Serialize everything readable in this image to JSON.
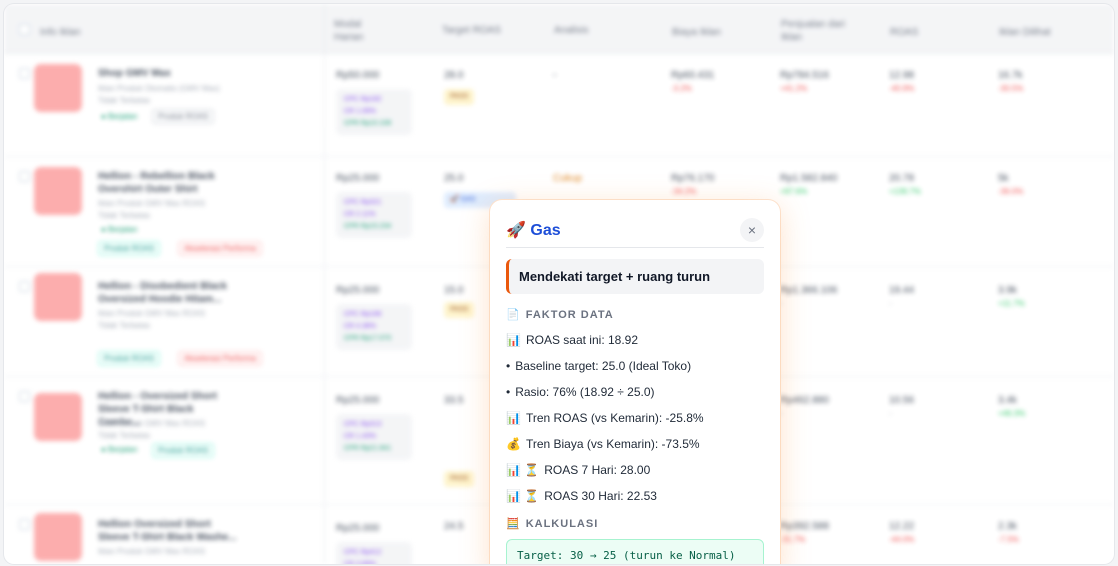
{
  "table": {
    "headers": {
      "info": "Info Iklan",
      "modal": "Modal Harian",
      "target": "Target ROAS",
      "analisis": "Analisis",
      "biaya": "Biaya Iklan",
      "penjualan": "Penjualan dari Iklan",
      "roas": "ROAS",
      "dilihat": "Iklan Dilihat"
    },
    "rows": [
      {
        "name": "Shop GMV Max",
        "sub1": "Iklan Produk Otomatis (GMV Max)",
        "sub2": "Tidak Terbatas",
        "status": "● Berjalan",
        "tag": "Produk ROAS",
        "modal": "Rp50.000",
        "target": "28.0",
        "analisis": "-",
        "biaya": "Rp60.431",
        "biaya_delta": "-3.2%",
        "penjualan": "Rp784.516",
        "penjualan_delta": "+41.2%",
        "roas": "12.98",
        "roas_delta": "-40.9%",
        "dilihat": "16.7k",
        "dilihat_delta": "-30.5%"
      },
      {
        "name": "Hellion - Rebellion Black Overshirt Outer Shirt",
        "sub1": "Iklan Produk GMV Max ROAS",
        "sub2": "Tidak Terbatas",
        "status": "● Berjalan",
        "tag": "Produk ROAS",
        "tag2": "Akselerasi Performa",
        "modal": "Rp25.000",
        "target": "25.0",
        "analisis": "Cukup",
        "biaya": "Rp76.170",
        "biaya_delta": "-34.2%",
        "penjualan": "Rp1.582.840",
        "penjualan_delta": "+97.6%",
        "roas": "20.78",
        "roas_delta": "+139.7%",
        "dilihat": "5k",
        "dilihat_delta": "-36.0%"
      },
      {
        "name": "Hellion - Disobedient Black Oversized Hoodie Hitam...",
        "sub1": "Iklan Produk GMV Max ROAS",
        "sub2": "Tidak Terbatas",
        "status": "",
        "tag": "Produk ROAS",
        "tag2": "Akselerasi Performa",
        "modal": "Rp25.000",
        "target": "15.0",
        "analisis": "",
        "biaya": "",
        "biaya_delta": "",
        "penjualan": "Rp1.366.106",
        "penjualan_delta": "-",
        "roas": "19.44",
        "roas_delta": "-",
        "dilihat": "3.9k",
        "dilihat_delta": "+11.7%"
      },
      {
        "name": "Hellion - Oversized Short Sleeve T-Shirt Black Combe...",
        "sub1": "Iklan Produk GMV Max ROAS",
        "sub2": "Tidak Terbatas",
        "status": "● Berjalan",
        "tag": "Produk ROAS",
        "modal": "Rp25.000",
        "target": "33.5",
        "analisis": "",
        "biaya": "",
        "biaya_delta": "",
        "penjualan": "Rp462.880",
        "penjualan_delta": "-",
        "roas": "10.56",
        "roas_delta": "-",
        "dilihat": "3.4k",
        "dilihat_delta": "+46.3%"
      },
      {
        "name": "Hellion Oversized Short Sleeve T-Shirt Black Washe...",
        "sub1": "Iklan Produk GMV Max ROAS",
        "sub2": "",
        "status": "",
        "tag": "",
        "modal": "Rp25.000",
        "target": "24.5",
        "analisis": "",
        "biaya": "",
        "biaya_delta": "",
        "penjualan": "Rp392.588",
        "penjualan_delta": "-31.7%",
        "roas": "12.22",
        "roas_delta": "-44.0%",
        "dilihat": "2.3k",
        "dilihat_delta": "-7.5%"
      }
    ],
    "pass_label": "PASS"
  },
  "modal": {
    "title": "Gas",
    "title_icon": "🚀",
    "close_glyph": "×",
    "headline": "Mendekati target + ruang turun",
    "faktor_title": "FAKTOR DATA",
    "faktor_icon": "📄",
    "facts": [
      {
        "icon": "📊",
        "text": "ROAS saat ini: 18.92"
      },
      {
        "icon": "•",
        "text": "Baseline target: 25.0 (Ideal Toko)"
      },
      {
        "icon": "•",
        "text": "Rasio: 76% (18.92 ÷ 25.0)"
      },
      {
        "icon": "📊",
        "text": "Tren ROAS (vs Kemarin): -25.8%"
      },
      {
        "icon": "💰",
        "text": "Tren Biaya (vs Kemarin): -73.5%"
      },
      {
        "icon": "📊 ⏳",
        "text": "ROAS 7 Hari: 28.00"
      },
      {
        "icon": "📊 ⏳",
        "text": "ROAS 30 Hari: 22.53"
      }
    ],
    "kalkulasi_title": "KALKULASI",
    "kalkulasi_icon": "🧮",
    "calc_text": "Target: 30 → 25 (turun ke Normal)"
  }
}
